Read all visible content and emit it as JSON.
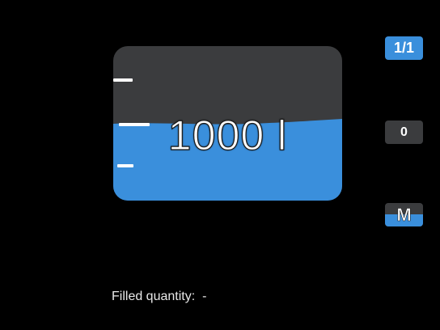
{
  "tank": {
    "volume_label": "1000 l",
    "fill_level_fraction": 0.54,
    "liquid_color": "#3a8fdc",
    "empty_color": "#3b3c3e"
  },
  "buttons": {
    "page_label": "1/1",
    "zero_label": "0",
    "mode_label": "M"
  },
  "status": {
    "filled_quantity_label": "Filled quantity:",
    "filled_quantity_value": "-"
  }
}
